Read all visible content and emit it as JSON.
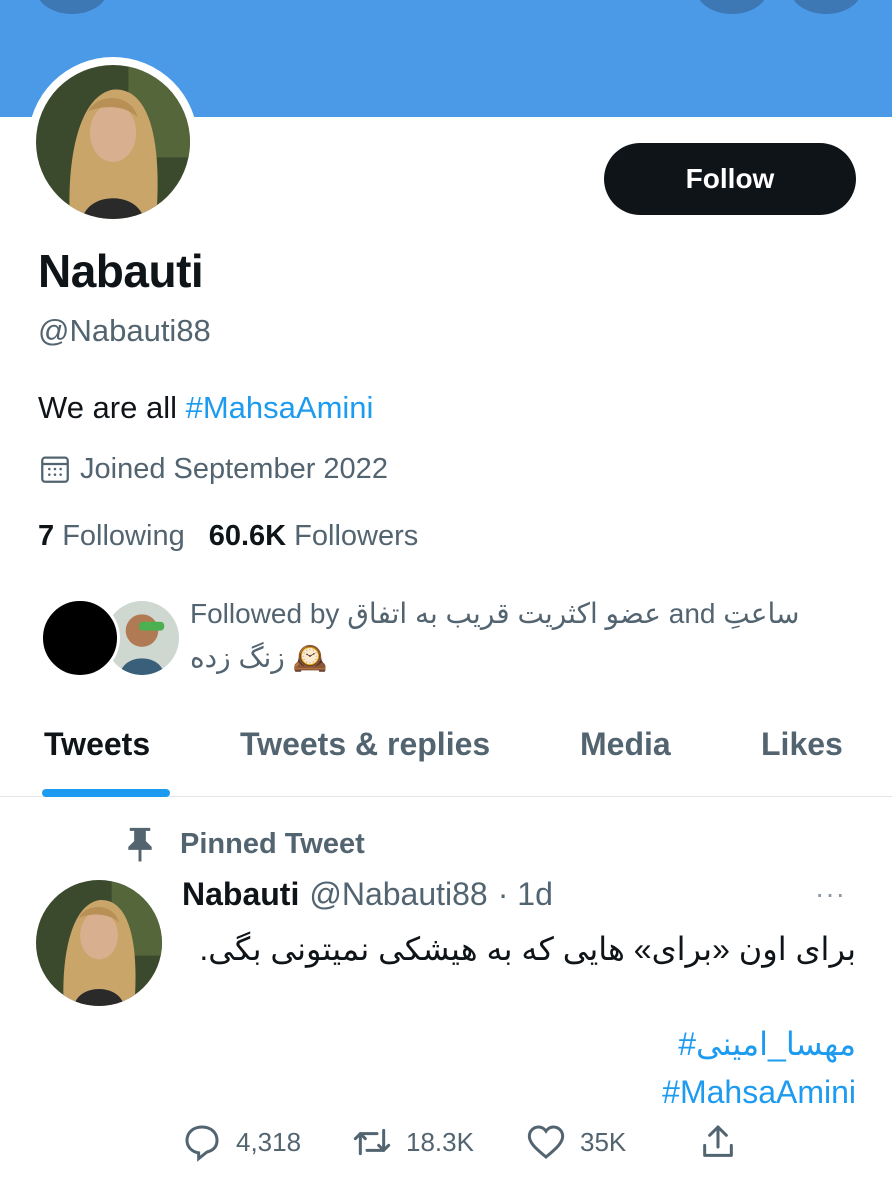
{
  "profile": {
    "display_name": "Nabauti",
    "handle": "@Nabauti88",
    "bio_text": "We are all ",
    "bio_hashtag": "#MahsaAmini",
    "joined": "Joined September 2022",
    "following_count": "7",
    "following_label": "Following",
    "followers_count": "60.6K",
    "followers_label": "Followers",
    "follow_button": "Follow",
    "followed_by_line1": "Followed by عضو اکثریت قریب به اتفاق and ساعتِ",
    "followed_by_line2": "زنگ زده 🕰️"
  },
  "tabs": [
    {
      "label": "Tweets",
      "active": true
    },
    {
      "label": "Tweets & replies",
      "active": false
    },
    {
      "label": "Media",
      "active": false
    },
    {
      "label": "Likes",
      "active": false
    }
  ],
  "tweet": {
    "pinned_label": "Pinned Tweet",
    "author_name": "Nabauti",
    "author_handle": "@Nabauti88",
    "time": "· 1d",
    "more": "···",
    "text": "برای اون «برای» هایی که به هیشکی نمیتونی بگی.",
    "hashtags": [
      "#مهسا_امینی",
      "#MahsaAmini"
    ],
    "replies": "4,318",
    "retweets": "18.3K",
    "likes": "35K"
  },
  "colors": {
    "banner": "#4a9ae8",
    "accent": "#1d9bf0",
    "text_primary": "#0f1419",
    "text_secondary": "#536471"
  },
  "icons": [
    "calendar-icon",
    "pin-icon",
    "reply-icon",
    "retweet-icon",
    "like-icon",
    "share-icon",
    "more-icon"
  ]
}
